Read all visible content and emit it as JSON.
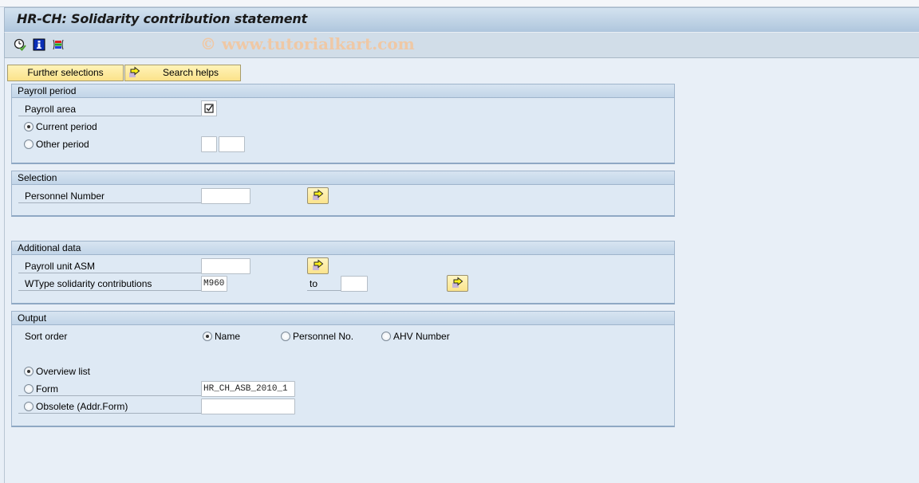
{
  "window": {
    "title": "HR-CH: Solidarity contribution statement",
    "watermark": "© www.tutorialkart.com"
  },
  "toolbar": {
    "icons": [
      "execute-icon",
      "info-icon",
      "selection-options-icon"
    ]
  },
  "buttons": {
    "further_selections": "Further selections",
    "search_helps": "Search helps"
  },
  "payroll_period": {
    "title": "Payroll period",
    "payroll_area_label": "Payroll area",
    "payroll_area_checked": true,
    "current_period_label": "Current period",
    "current_period_selected": true,
    "other_period_label": "Other period",
    "other_period_selected": false,
    "other_period_value1": "",
    "other_period_value2": ""
  },
  "selection": {
    "title": "Selection",
    "personnel_number_label": "Personnel Number",
    "personnel_number_value": ""
  },
  "additional_data": {
    "title": "Additional data",
    "payroll_unit_label": "Payroll unit ASM",
    "payroll_unit_value": "",
    "wtype_label": "WType solidarity contributions",
    "wtype_from": "M960",
    "to_label": "to",
    "wtype_to": ""
  },
  "output": {
    "title": "Output",
    "sort_order_label": "Sort order",
    "sort_options": [
      {
        "label": "Name",
        "selected": true
      },
      {
        "label": "Personnel No.",
        "selected": false
      },
      {
        "label": "AHV Number",
        "selected": false
      }
    ],
    "overview_list_label": "Overview list",
    "overview_list_selected": true,
    "form_label": "Form",
    "form_selected": false,
    "form_value": "HR_CH_ASB_2010_1",
    "obsolete_label": "Obsolete (Addr.Form)",
    "obsolete_selected": false,
    "obsolete_value": ""
  }
}
